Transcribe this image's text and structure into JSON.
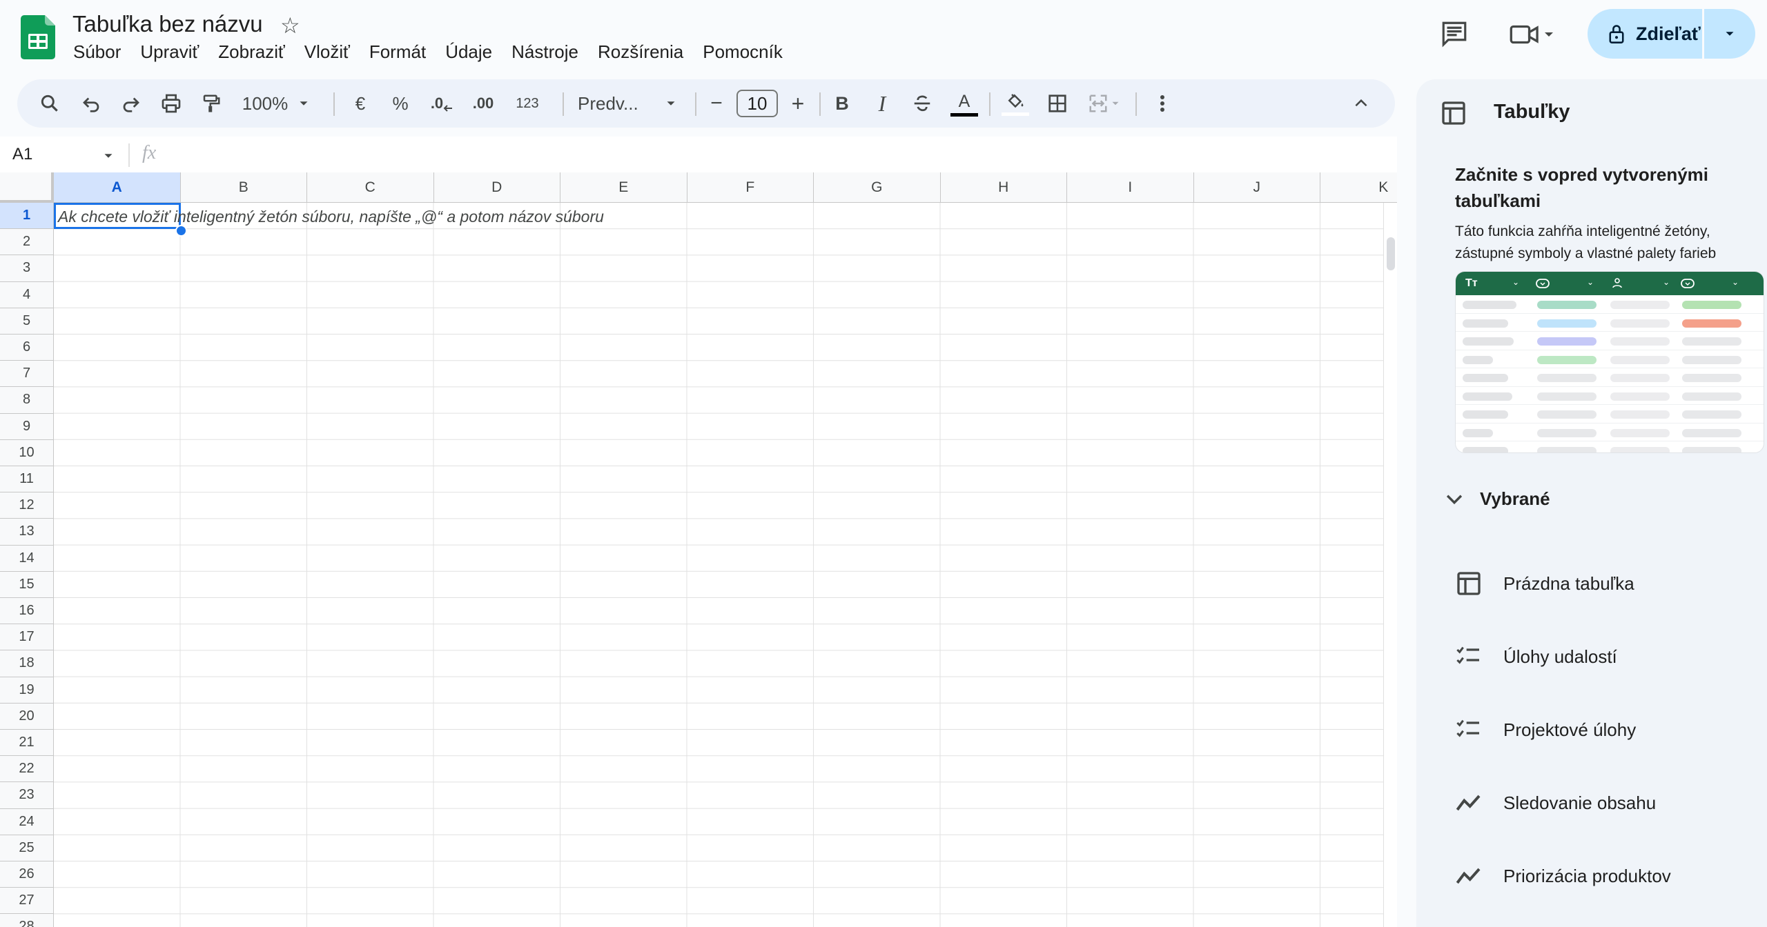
{
  "app": {
    "doc_title": "Tabuľka bez názvu",
    "menu": [
      "Súbor",
      "Upraviť",
      "Zobraziť",
      "Vložiť",
      "Formát",
      "Údaje",
      "Nástroje",
      "Rozšírenia",
      "Pomocník"
    ],
    "share_label": "Zdieľať"
  },
  "toolbar": {
    "zoom": "100%",
    "currency": "€",
    "percent": "%",
    "dec_decrease": ".0",
    "dec_increase": ".00",
    "number_format": "123",
    "font": "Predv...",
    "font_size": "10",
    "bold": "B",
    "italic": "I",
    "text_color": "A",
    "minus": "−",
    "plus": "+"
  },
  "formula_bar": {
    "name_box": "A1",
    "fx": "fx",
    "value": ""
  },
  "sheet": {
    "columns": [
      "A",
      "B",
      "C",
      "D",
      "E",
      "F",
      "G",
      "H",
      "I",
      "J",
      "K"
    ],
    "rows": [
      "1",
      "2",
      "3",
      "4",
      "5",
      "6",
      "7",
      "8",
      "9",
      "10",
      "11",
      "12",
      "13",
      "14",
      "15",
      "16",
      "17",
      "18",
      "19",
      "20",
      "21",
      "22",
      "23",
      "24",
      "25",
      "26",
      "27",
      "28"
    ],
    "selected_cell": "A1",
    "cell_hint": "Ak chcete vložiť inteligentný žetón súboru, napíšte „@“ a potom názov súboru"
  },
  "panel": {
    "title": "Tabuľky",
    "heading": "Začnite s vopred vytvorenými tabuľkami",
    "description": "Táto funkcia zahŕňa inteligentné žetóny, zástupné symboly a vlastné palety farieb",
    "preview_header": "Tт",
    "section": "Vybrané",
    "templates": [
      {
        "label": "Prázdna tabuľka",
        "icon": "table-icon"
      },
      {
        "label": "Úlohy udalostí",
        "icon": "checklist-icon"
      },
      {
        "label": "Projektové úlohy",
        "icon": "checklist-icon"
      },
      {
        "label": "Sledovanie obsahu",
        "icon": "trend-icon"
      },
      {
        "label": "Priorizácia produktov",
        "icon": "trend-icon"
      }
    ]
  },
  "colors": {
    "accent": "#1a73e8",
    "share_bg": "#c2e7ff",
    "sheets_green": "#0f9d58",
    "preview_header": "#1e6b47"
  }
}
